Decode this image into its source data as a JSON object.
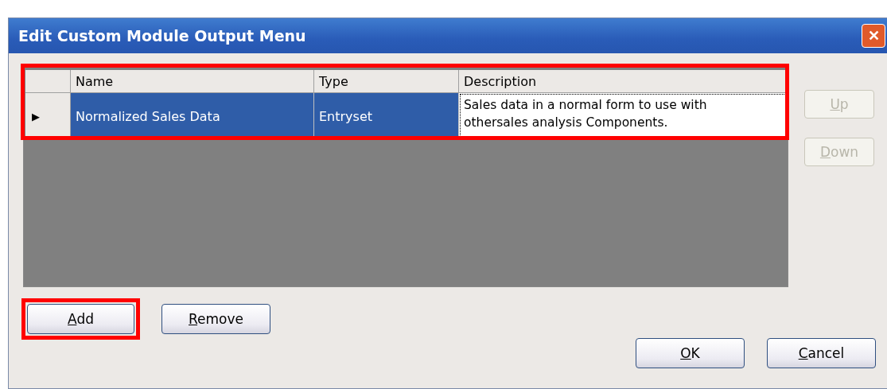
{
  "window": {
    "title": "Edit Custom Module Output Menu",
    "close": "✕"
  },
  "grid": {
    "highlighted": true,
    "columns": [
      "Name",
      "Type",
      "Description"
    ],
    "rows": [
      {
        "selected": true,
        "current": "▶",
        "cells": [
          "Normalized Sales Data",
          "Entryset",
          "Sales data in a normal form to use with othersales analysis Components."
        ]
      }
    ]
  },
  "side_buttons": [
    {
      "mnemonic": "U",
      "rest": "p",
      "disabled": true
    },
    {
      "mnemonic": "D",
      "rest": "own",
      "disabled": true
    }
  ],
  "list_buttons": [
    {
      "mnemonic": "A",
      "rest": "dd",
      "highlighted": true
    },
    {
      "mnemonic": "R",
      "rest": "emove",
      "highlighted": false
    }
  ],
  "dialog_buttons": [
    {
      "mnemonic": "O",
      "rest": "K",
      "disabled": false
    },
    {
      "mnemonic": "C",
      "rest": "ancel",
      "disabled": false
    }
  ]
}
